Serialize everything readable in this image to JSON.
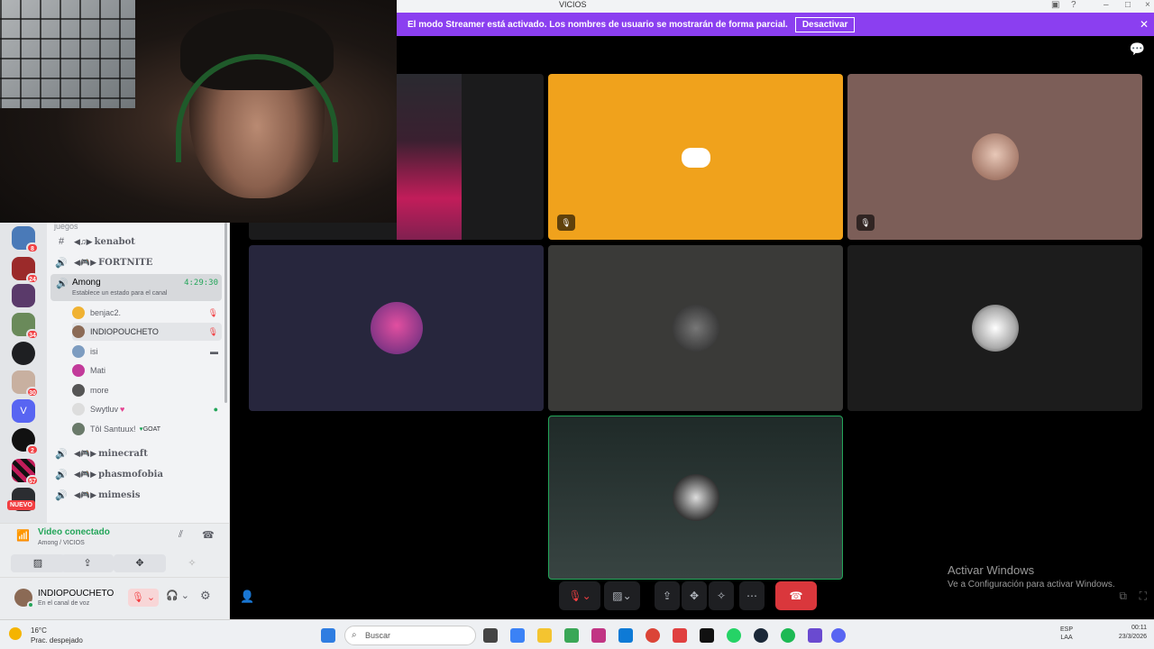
{
  "titlebar": {
    "title": "VICIOS"
  },
  "banner": {
    "text": "El modo Streamer está activado. Los nombres de usuario se mostrarán de forma parcial.",
    "button": "Desactivar"
  },
  "sidebar": {
    "category": "juegos",
    "channels": [
      {
        "kind": "text",
        "name": "kenabot"
      },
      {
        "kind": "voice",
        "name": "FORTNITE"
      }
    ],
    "active_voice": {
      "name": "Among",
      "time": "4:29:30",
      "status_hint": "Establece un estado para el canal"
    },
    "members": [
      {
        "name": "benjac2.",
        "right": "mic-off"
      },
      {
        "name": "INDIOPOUCHETO",
        "right": "mic-off"
      },
      {
        "name": "isi",
        "right": "camera"
      },
      {
        "name": "Mati",
        "right": ""
      },
      {
        "name": "more",
        "right": ""
      },
      {
        "name": "Swytluv",
        "right": "stream"
      },
      {
        "name": "Tôl Santuux!",
        "tag": "GOAT",
        "right": ""
      }
    ],
    "more_channels": [
      "minecraft",
      "phasmofobia",
      "mimesis"
    ],
    "guild_badges": [
      "8",
      "24",
      "",
      "34",
      "",
      "30",
      "",
      "2",
      "57",
      ""
    ],
    "new_label": "NUEVO"
  },
  "voice_panel": {
    "connected": "Video conectado",
    "location": "Among / VICIOS"
  },
  "user_panel": {
    "username": "INDIOPOUCHETO",
    "status": "En el canal de voz"
  },
  "watermark": {
    "line1": "Activar Windows",
    "line2": "Ve a Configuración para activar Windows."
  },
  "taskbar": {
    "weather_temp": "16°C",
    "weather_desc": "Prac. despejado",
    "search_placeholder": "Buscar",
    "lang1": "ESP",
    "lang2": "LAA",
    "time": "00:11",
    "date": "23/3/2026"
  },
  "colors": {
    "banner": "#8b3ff0",
    "discord_tile": "#f0a21c",
    "speaking": "#23a559",
    "danger": "#f23f42"
  }
}
